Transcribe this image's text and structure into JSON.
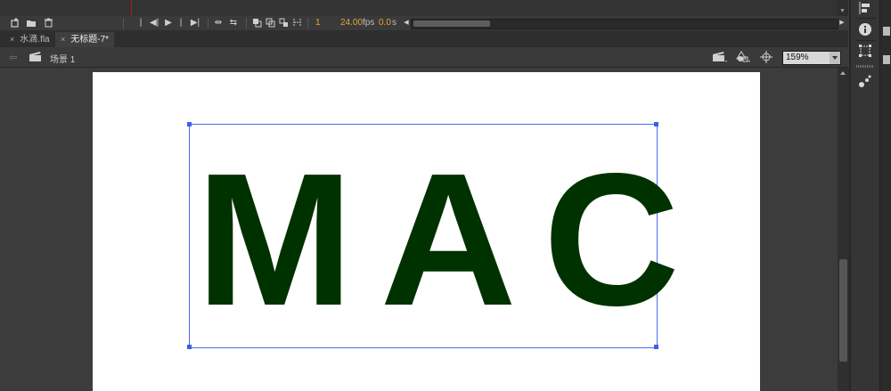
{
  "timeline": {
    "current_frame": "1",
    "fps_value": "24.00",
    "fps_unit": "fps",
    "time_value": "0.0",
    "time_unit": "s"
  },
  "tabs": [
    {
      "label": "水滴.fla",
      "close": "×",
      "active": false
    },
    {
      "label": "无标题-7*",
      "close": "×",
      "active": true
    }
  ],
  "editbar": {
    "scene_label": "场景 1",
    "zoom_value": "159%"
  },
  "stage": {
    "text_content": "MAC",
    "text_color": "#003200",
    "selection_color": "#4a6cf0",
    "stage_color": "#ffffff"
  },
  "icons": {
    "new_layer": "new-layer-icon",
    "new_folder": "new-folder-icon",
    "delete_layer": "delete-icon",
    "first_frame": "first-frame-icon",
    "step_back": "step-back-icon",
    "play": "play-icon",
    "step_forward": "step-forward-icon",
    "last_frame": "last-frame-icon",
    "center_frame": "center-frame-icon",
    "loop": "loop-icon",
    "onion_skin": "onion-skin-icon",
    "onion_outline": "onion-outline-icon",
    "edit_multiple": "edit-multiple-icon",
    "modify_markers": "modify-markers-icon",
    "back_arrow": "back-arrow-icon",
    "clapboard": "clapboard-icon",
    "edit_scene": "edit-scene-icon",
    "edit_symbol": "edit-symbol-icon",
    "center_stage": "center-stage-icon",
    "align_panel": "align-panel-icon",
    "info_panel": "info-panel-icon",
    "transform_panel": "transform-panel-icon",
    "motion_presets": "motion-presets-icon"
  }
}
